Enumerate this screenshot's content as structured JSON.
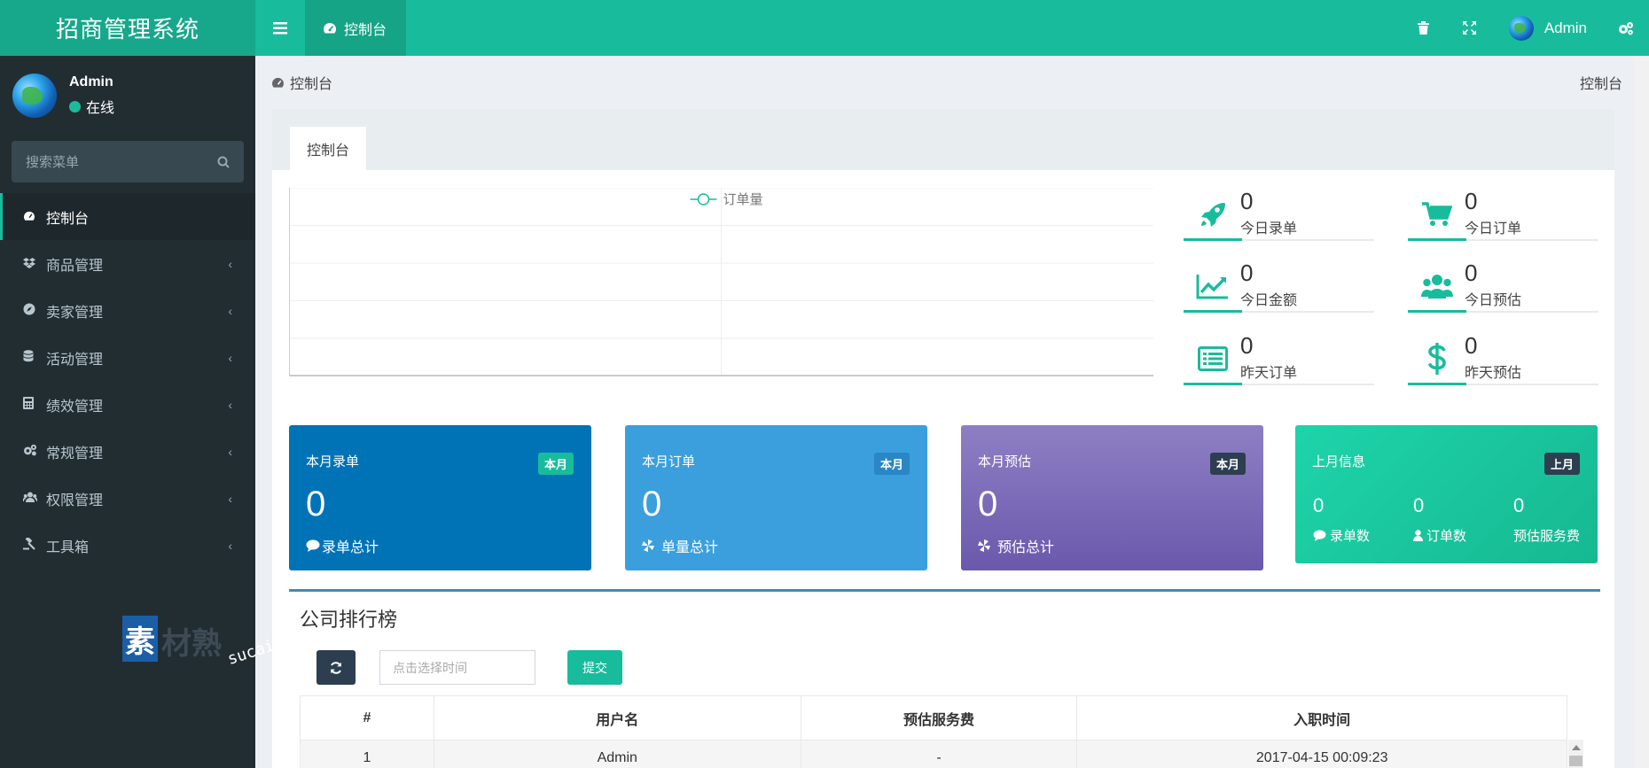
{
  "app": {
    "title": "招商管理系统"
  },
  "header": {
    "active_tab": "控制台",
    "user_name": "Admin"
  },
  "sidebar": {
    "user": {
      "name": "Admin",
      "status": "在线"
    },
    "search_placeholder": "搜索菜单",
    "items": [
      {
        "label": "控制台",
        "icon": "dashboard-icon"
      },
      {
        "label": "商品管理",
        "icon": "dropbox-icon"
      },
      {
        "label": "卖家管理",
        "icon": "compass-icon"
      },
      {
        "label": "活动管理",
        "icon": "database-icon"
      },
      {
        "label": "绩效管理",
        "icon": "calculator-icon"
      },
      {
        "label": "常规管理",
        "icon": "gears-icon"
      },
      {
        "label": "权限管理",
        "icon": "users-icon"
      },
      {
        "label": "工具箱",
        "icon": "gavel-icon"
      }
    ],
    "watermark": {
      "char": "素",
      "rest": "材熟",
      "url": "sucaire.com"
    }
  },
  "breadcrumb": {
    "left": "控制台",
    "right": "控制台"
  },
  "panel": {
    "tab": "控制台"
  },
  "chart_data": {
    "type": "line",
    "legend": [
      "订单量"
    ],
    "series": [
      {
        "name": "订单量",
        "values": []
      }
    ],
    "x": [],
    "grid": true,
    "legend_placement": "top-center",
    "color": "#18bc9c"
  },
  "stats": [
    {
      "value": "0",
      "label": "今日录单",
      "icon": "rocket-icon"
    },
    {
      "value": "0",
      "label": "今日订单",
      "icon": "cart-icon"
    },
    {
      "value": "0",
      "label": "今日金额",
      "icon": "line-chart-icon"
    },
    {
      "value": "0",
      "label": "今日预估",
      "icon": "users-icon"
    },
    {
      "value": "0",
      "label": "昨天订单",
      "icon": "list-icon"
    },
    {
      "value": "0",
      "label": "昨天预估",
      "icon": "dollar-icon"
    }
  ],
  "cards": [
    {
      "title": "本月录单",
      "badge": "本月",
      "value": "0",
      "sub": "录单总计",
      "color": "#0073b7",
      "badge_color": "#18bc9c"
    },
    {
      "title": "本月订单",
      "badge": "本月",
      "value": "0",
      "sub": "单量总计",
      "color": "#3b9fdd",
      "badge_color": "#2a86c4"
    },
    {
      "title": "本月预估",
      "badge": "本月",
      "value": "0",
      "sub": "预估总计",
      "color": "#7a66b4",
      "badge_color": "#2c3e50"
    },
    {
      "title": "上月信息",
      "badge": "上月",
      "color": "#18c59e",
      "badge_color": "#2c3e50",
      "items": [
        {
          "value": "0",
          "label": "录单数"
        },
        {
          "value": "0",
          "label": "订单数"
        },
        {
          "value": "0",
          "label": "预估服务费"
        }
      ]
    }
  ],
  "ranking": {
    "title": "公司排行榜",
    "date_placeholder": "点击选择时间",
    "submit_label": "提交",
    "columns": [
      "#",
      "用户名",
      "预估服务费",
      "入职时间"
    ],
    "rows": [
      [
        "1",
        "Admin",
        "-",
        "2017-04-15 00:09:23"
      ]
    ]
  }
}
